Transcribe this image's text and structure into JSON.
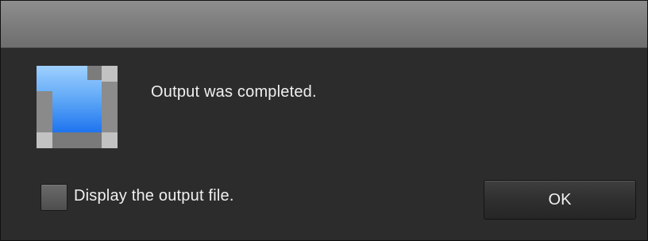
{
  "dialog": {
    "message": "Output was completed.",
    "icon": "output-complete-icon"
  },
  "options": {
    "display_output_label": "Display the output file.",
    "display_output_checked": false
  },
  "buttons": {
    "ok_label": "OK"
  },
  "colors": {
    "background": "#2c2c2c",
    "titlebar": "#7d7d7d",
    "text": "#f0f0f0",
    "icon_blue": "#3a8ef5",
    "icon_gray": "#8a8a8a"
  }
}
